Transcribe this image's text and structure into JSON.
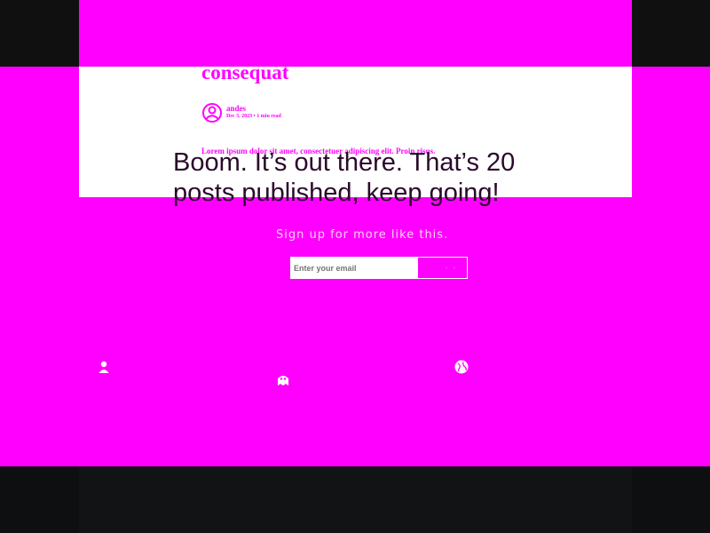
{
  "post": {
    "title": "consequat",
    "author": "andes",
    "date": "Dec 3, 2023",
    "separator": "•",
    "read_time": "1 min read",
    "excerpt": "Lorem ipsum dolor sit amet, consectetuer adipiscing elit. Proin risus."
  },
  "publish": {
    "headline_main": "Boom. It’s out there. That’s 20 posts published, keep",
    "headline_tail": "going!",
    "signup_label": "Sign up for more like this.",
    "email_placeholder": "Enter your email",
    "submit_label": "· ·"
  },
  "icons": {
    "left": "person-icon",
    "center": "ghost-icon",
    "right": "globe-icon"
  },
  "colors": {
    "brand": "#ff00ff",
    "background_dark": "#101010",
    "card": "#ffffff"
  }
}
